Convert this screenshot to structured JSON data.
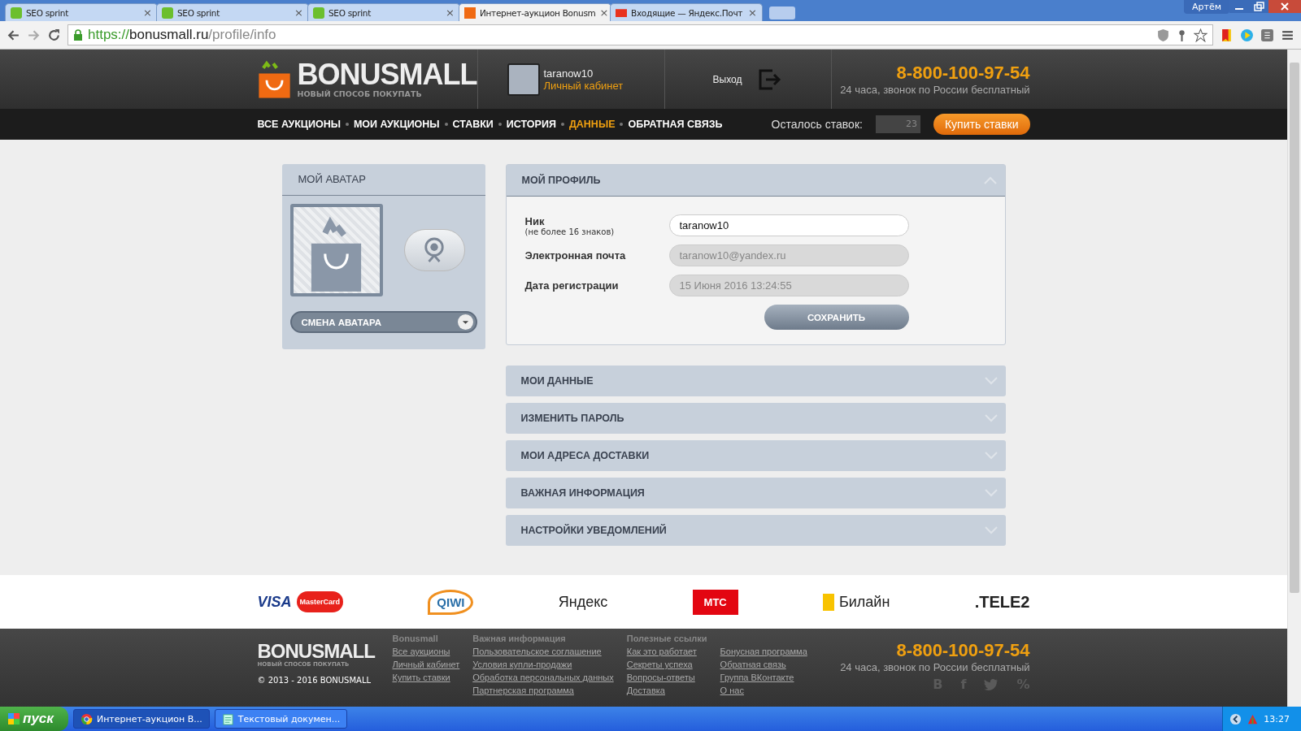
{
  "browser": {
    "tabs": [
      {
        "title": "SEO sprint",
        "kind": "seo",
        "close": "×",
        "selected": false
      },
      {
        "title": "SEO sprint",
        "kind": "seo",
        "close": "×",
        "selected": false
      },
      {
        "title": "SEO sprint",
        "kind": "seo",
        "close": "×",
        "selected": false
      },
      {
        "title": "Интернет-аукцион Bonusm",
        "kind": "shop",
        "close": "×",
        "selected": true
      },
      {
        "title": "Входящие — Яндекс.Почт",
        "kind": "mail",
        "close": "×",
        "selected": false
      }
    ],
    "user": "Артём",
    "url_scheme": "https://",
    "url_host": "bonusmall.ru",
    "url_path": "/profile/info"
  },
  "header": {
    "logo": "BONUSMALL",
    "logo_tagline": "НОВЫЙ СПОСОБ ПОКУПАТЬ",
    "username": "taranow10",
    "cabinet_link": "Личный кабинет",
    "logout": "Выход",
    "phone": "8-800-100-97-54",
    "phone_note": "24 часа, звонок по России бесплатный"
  },
  "nav": {
    "items": [
      {
        "label": "ВСЕ АУКЦИОНЫ",
        "selected": false
      },
      {
        "label": "МОИ АУКЦИОНЫ",
        "selected": false
      },
      {
        "label": "СТАВКИ",
        "selected": false
      },
      {
        "label": "ИСТОРИЯ",
        "selected": false
      },
      {
        "label": "ДАННЫЕ",
        "selected": true
      },
      {
        "label": "ОБРАТНАЯ СВЯЗЬ",
        "selected": false
      }
    ],
    "bids_label": "Осталось ставок:",
    "bids_value": "23",
    "buy_button": "Купить ставки"
  },
  "avatar_panel": {
    "title": "МОЙ АВАТАР",
    "change_button": "СМЕНА АВАТАРА"
  },
  "profile": {
    "title": "МОЙ ПРОФИЛЬ",
    "expanded": true,
    "fields": [
      {
        "label": "Ник",
        "hint": "(не более 16 знаков)",
        "value": "taranow10",
        "disabled": false
      },
      {
        "label": "Электронная почта",
        "value": "taranow10@yandex.ru",
        "disabled": true
      },
      {
        "label": "Дата регистрации",
        "value": "15 Июня 2016 13:24:55",
        "disabled": true
      }
    ],
    "save_button": "СОХРАНИТЬ"
  },
  "sections": [
    {
      "title": "МОИ ДАННЫЕ",
      "expanded": false
    },
    {
      "title": "ИЗМЕНИТЬ ПАРОЛЬ",
      "expanded": false
    },
    {
      "title": "МОИ АДРЕСА ДОСТАВКИ",
      "expanded": false
    },
    {
      "title": "ВАЖНАЯ ИНФОРМАЦИЯ",
      "expanded": false
    },
    {
      "title": "НАСТРОЙКИ УВЕДОМЛЕНИЙ",
      "expanded": false
    }
  ],
  "payments": [
    {
      "kind": "visa",
      "label": "VISA"
    },
    {
      "kind": "mastercard",
      "label": "MasterCard"
    },
    {
      "kind": "qiwi",
      "label": "QIWI"
    },
    {
      "kind": "yandex",
      "label": "Яндекс"
    },
    {
      "kind": "mts",
      "label": "МТС"
    },
    {
      "kind": "beeline",
      "label": "Билайн"
    },
    {
      "kind": "tele2",
      "label": ".TELE2"
    }
  ],
  "footer": {
    "logo": "BONUSMALL",
    "logo_tagline": "НОВЫЙ СПОСОБ ПОКУПАТЬ",
    "copyright": "© 2013 - 2016 BONUSMALL",
    "columns": [
      {
        "title": "Bonusmall",
        "links": [
          "Все аукционы",
          "Личный кабинет",
          "Купить ставки"
        ]
      },
      {
        "title": "Важная информация",
        "links": [
          "Пользовательское соглашение",
          "Условия купли-продажи",
          "Обработка персональных данных",
          "Партнерская программа"
        ]
      },
      {
        "title": "Полезные ссылки",
        "links": [
          "Как это работает",
          "Секреты успеха",
          "Вопросы-ответы",
          "Доставка"
        ]
      },
      {
        "links": [
          "Бонусная программа",
          "Обратная связь",
          "Группа ВКонтакте",
          "О нас"
        ]
      }
    ],
    "phone": "8-800-100-97-54",
    "phone_note": "24 часа, звонок по России бесплатный",
    "social": [
      {
        "kind": "vk",
        "label": "B"
      },
      {
        "kind": "facebook",
        "label": "f"
      },
      {
        "kind": "twitter"
      },
      {
        "kind": "percent",
        "label": "%"
      }
    ]
  },
  "taskbar": {
    "start": "пуск",
    "tasks": [
      {
        "title": "Интернет-аукцион B...",
        "kind": "browser",
        "selected": true
      },
      {
        "title": "Текстовый докумен...",
        "kind": "notepad",
        "selected": false
      }
    ],
    "time": "13:27"
  }
}
